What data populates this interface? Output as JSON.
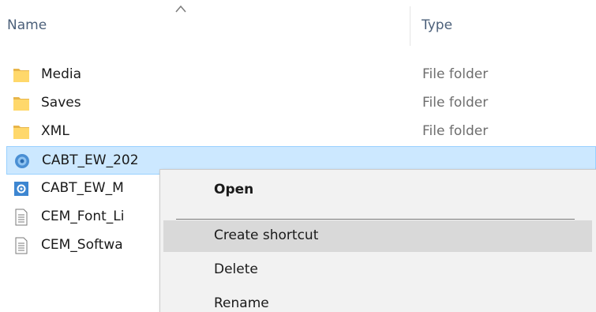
{
  "columns": {
    "name": "Name",
    "type": "Type"
  },
  "files": [
    {
      "name": "Media",
      "type": "File folder",
      "icon": "folder-icon"
    },
    {
      "name": "Saves",
      "type": "File folder",
      "icon": "folder-icon"
    },
    {
      "name": "XML",
      "type": "File folder",
      "icon": "folder-icon"
    },
    {
      "name": "CABT_EW_202",
      "type": "",
      "icon": "application-icon",
      "selected": true
    },
    {
      "name": "CABT_EW_M",
      "type": "",
      "icon": "settings-app-icon"
    },
    {
      "name": "CEM_Font_Li",
      "type": "",
      "icon": "text-document-icon"
    },
    {
      "name": "CEM_Softwa",
      "type": "",
      "icon": "text-document-icon"
    }
  ],
  "context_menu": {
    "items": [
      {
        "label": "Open",
        "bold": true
      },
      {
        "label": "Create shortcut",
        "hover": true
      },
      {
        "label": "Delete"
      },
      {
        "label": "Rename"
      }
    ]
  },
  "colors": {
    "selection_bg": "#cce8ff",
    "selection_border": "#99d1ff",
    "menu_bg": "#f2f2f2",
    "menu_hover": "#d9d9d9",
    "folder_yellow": "#ffd86b"
  }
}
